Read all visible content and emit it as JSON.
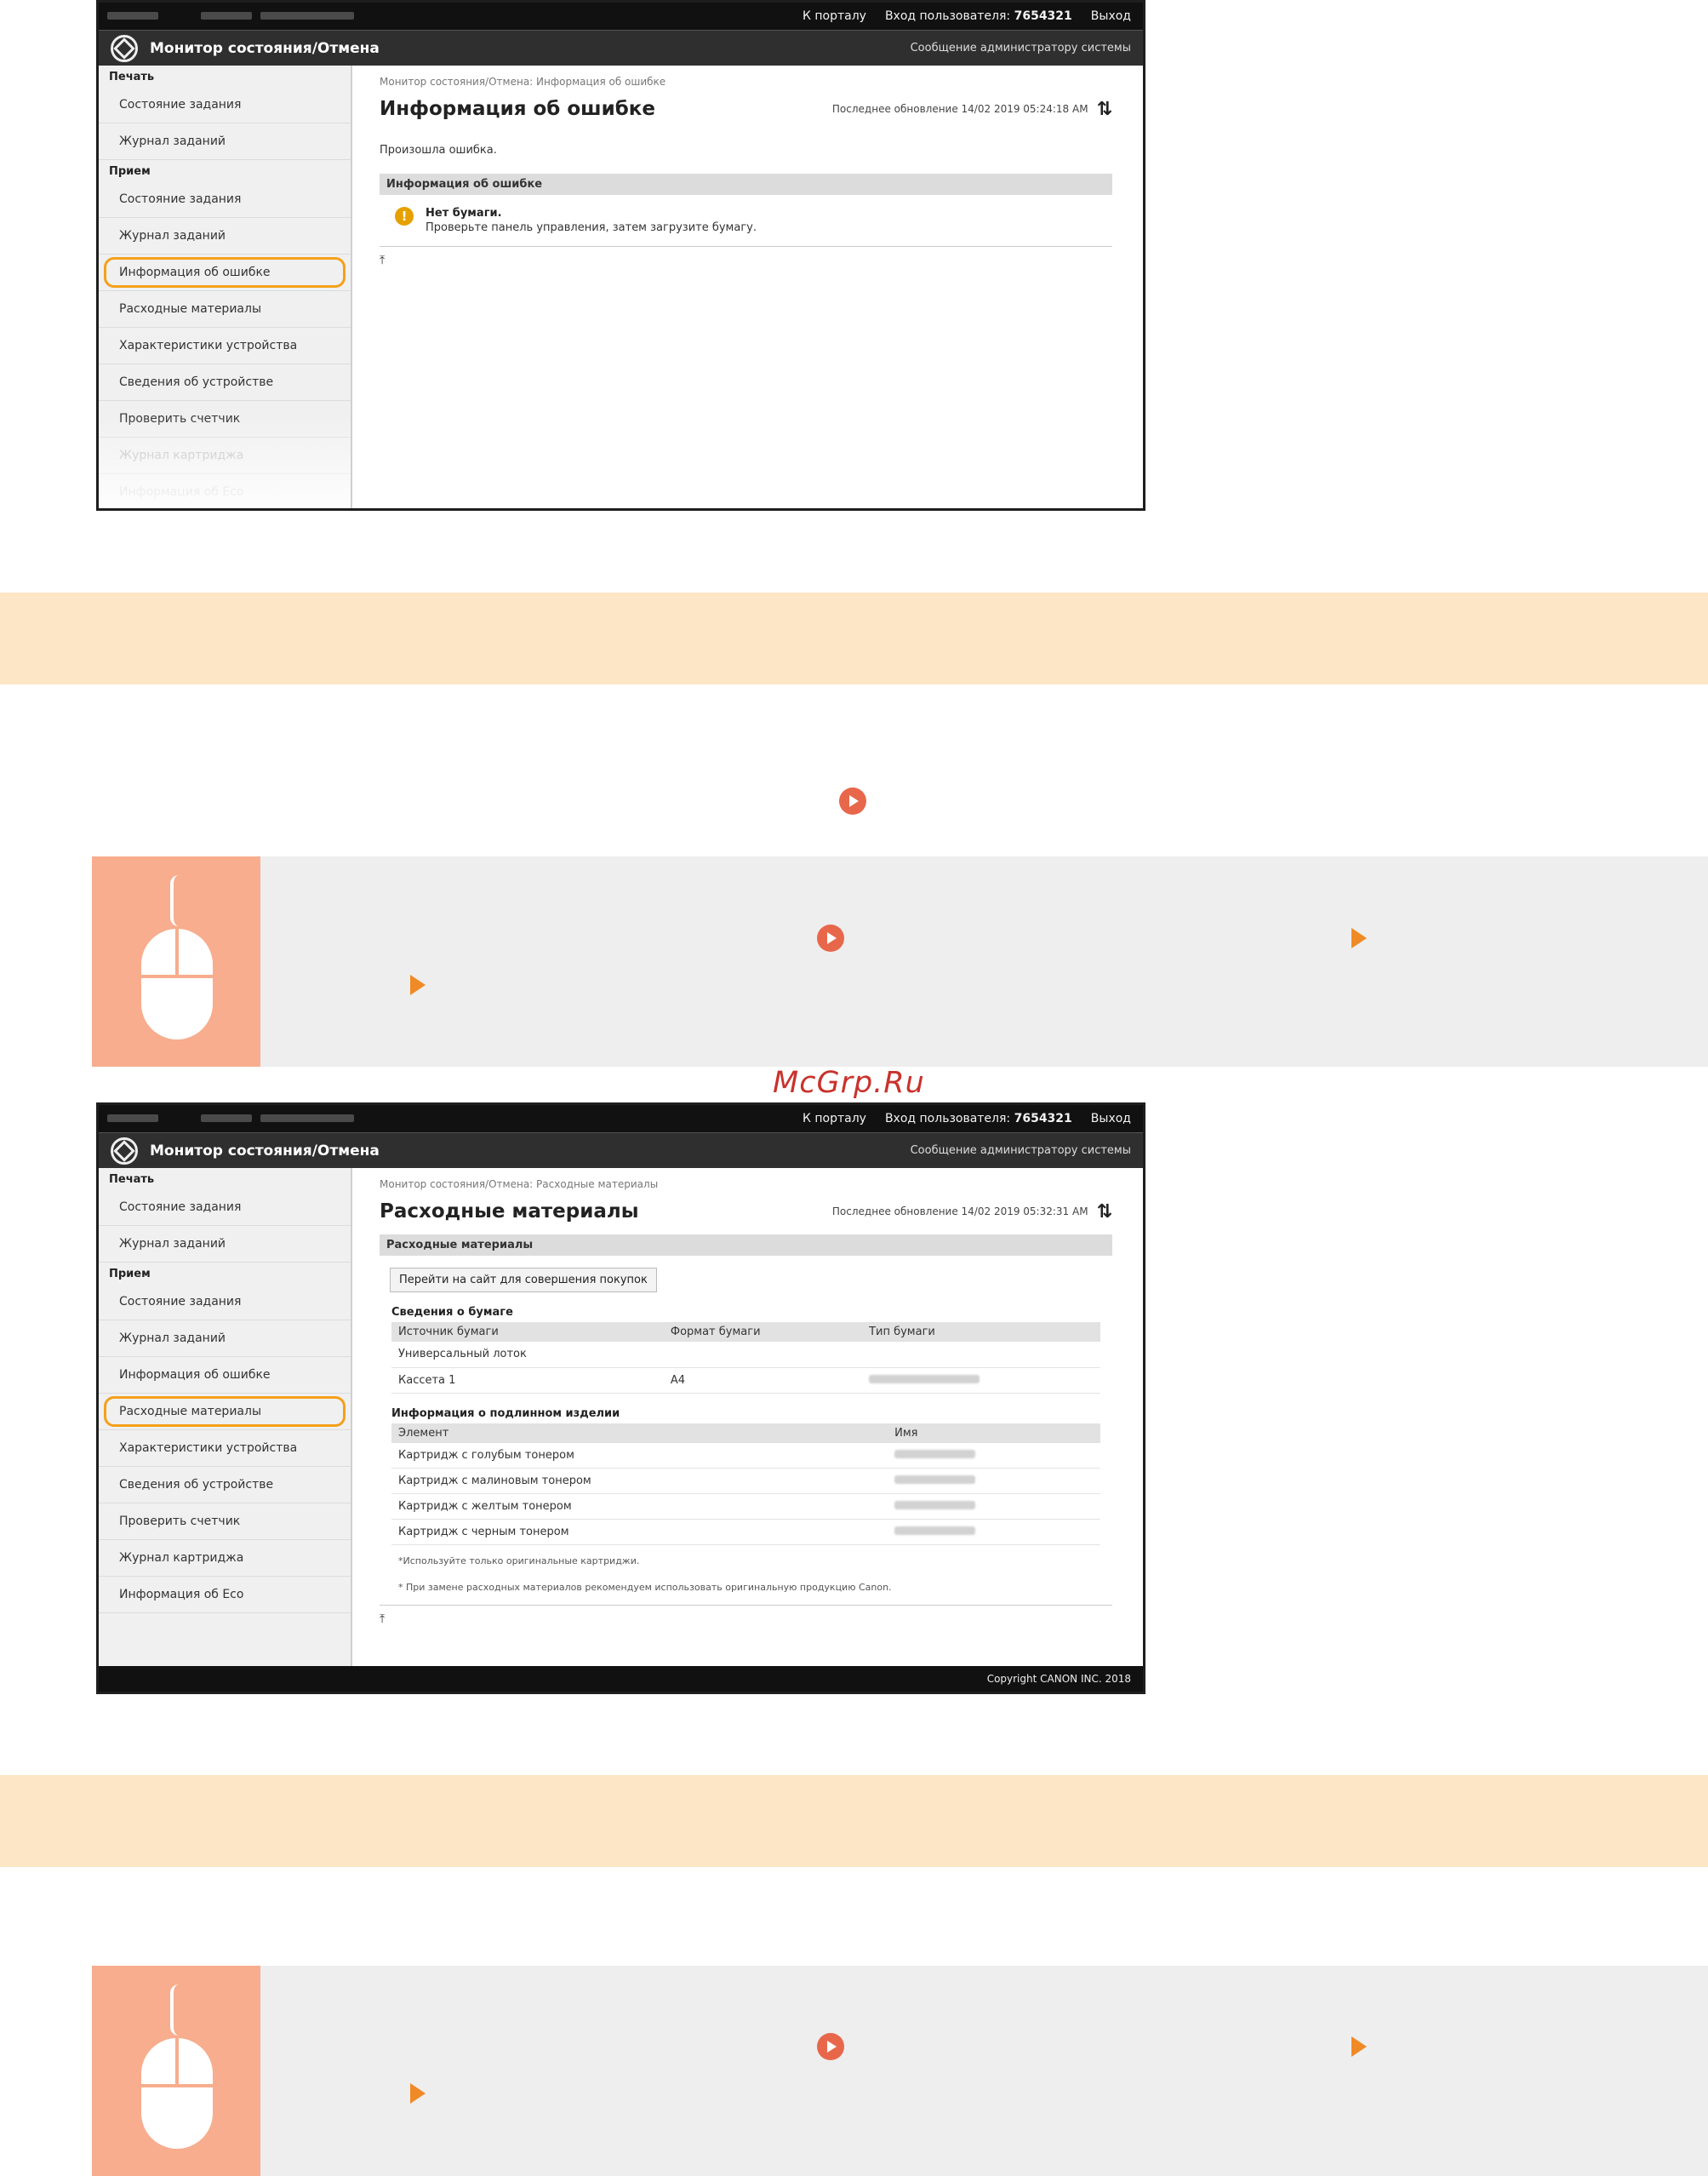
{
  "topbar": {
    "portal_link": "К порталу",
    "login_label": "Вход пользователя:",
    "user_id": "7654321",
    "logout_link": "Выход"
  },
  "header": {
    "app_title": "Монитор состояния/Отмена",
    "admin_link": "Сообщение администратору системы"
  },
  "sidebar": {
    "print_section": "Печать",
    "print_job_status": "Состояние задания",
    "print_job_log": "Журнал заданий",
    "receive_section": "Прием",
    "recv_job_status": "Состояние задания",
    "recv_job_log": "Журнал заданий",
    "error_info": "Информация об ошибке",
    "consumables": "Расходные материалы",
    "device_features": "Характеристики устройства",
    "device_info": "Сведения об устройстве",
    "check_counter": "Проверить счетчик",
    "cartridge_log": "Журнал картриджа",
    "eco_info": "Информация об Eco",
    "eco_info_faded": "Информация об Eco"
  },
  "screen1": {
    "breadcrumb": "Монитор состояния/Отмена: Информация об ошибке",
    "title": "Информация об ошибке",
    "last_updated": "Последнее обновление 14/02 2019 05:24:18 AM",
    "note": "Произошла ошибка.",
    "section": "Информация об ошибке",
    "error_title": "Нет бумаги.",
    "error_detail": "Проверьте панель управления, затем загрузите бумагу."
  },
  "screen2": {
    "breadcrumb": "Монитор состояния/Отмена: Расходные материалы",
    "title": "Расходные материалы",
    "last_updated": "Последнее обновление 14/02 2019 05:32:31 AM",
    "section": "Расходные материалы",
    "buy_button": "Перейти на сайт для совершения покупок",
    "paper_group": "Сведения о бумаге",
    "paper_headers": [
      "Источник бумаги",
      "Формат бумаги",
      "Тип бумаги"
    ],
    "paper_rows": [
      {
        "source": "Универсальный лоток",
        "size": ""
      },
      {
        "source": "Кассета 1",
        "size": "A4"
      }
    ],
    "parts_group": "Информация о подлинном изделии",
    "parts_headers": [
      "Элемент",
      "Имя"
    ],
    "parts_rows": [
      "Картридж с голубым тонером",
      "Картридж с малиновым тонером",
      "Картридж с желтым тонером",
      "Картридж с черным тонером"
    ],
    "note1": "*Используйте только оригинальные картриджи.",
    "note2": "* При замене расходных материалов рекомендуем использовать оригинальную продукцию Canon.",
    "copyright": "Copyright CANON INC. 2018"
  },
  "watermark": "McGrp.Ru",
  "colors": {
    "step_band": "#fce6c6",
    "bullet": "#e8674b",
    "arrow": "#ef8a26",
    "highlight": "#f5a01a",
    "op_icon_bg": "#f7ad8e"
  }
}
